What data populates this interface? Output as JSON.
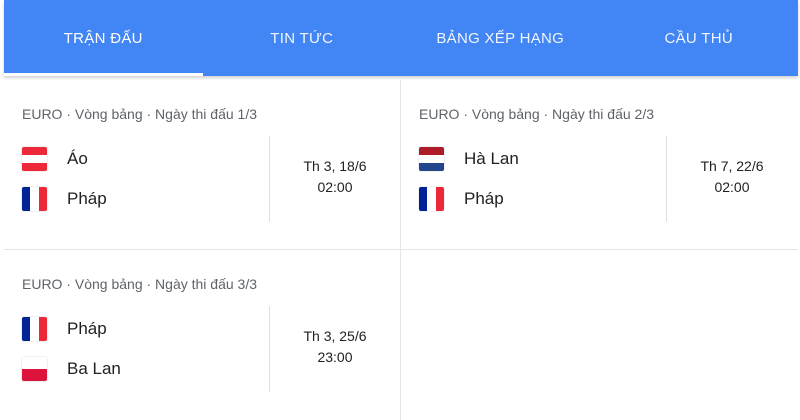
{
  "tabs": [
    {
      "label": "TRẬN ĐẤU",
      "active": true
    },
    {
      "label": "TIN TỨC",
      "active": false
    },
    {
      "label": "BẢNG XẾP HẠNG",
      "active": false
    },
    {
      "label": "CẦU THỦ",
      "active": false
    }
  ],
  "matches": [
    {
      "header": "EURO · Vòng bảng · Ngày thi đấu 1/3",
      "home": {
        "name": "Áo",
        "flag": "austria-flag"
      },
      "away": {
        "name": "Pháp",
        "flag": "france-flag"
      },
      "date": "Th 3, 18/6",
      "time": "02:00"
    },
    {
      "header": "EURO · Vòng bảng · Ngày thi đấu 2/3",
      "home": {
        "name": "Hà Lan",
        "flag": "netherlands-flag"
      },
      "away": {
        "name": "Pháp",
        "flag": "france-flag"
      },
      "date": "Th 7, 22/6",
      "time": "02:00"
    },
    {
      "header": "EURO · Vòng bảng · Ngày thi đấu 3/3",
      "home": {
        "name": "Pháp",
        "flag": "france-flag"
      },
      "away": {
        "name": "Ba Lan",
        "flag": "poland-flag"
      },
      "date": "Th 3, 25/6",
      "time": "23:00"
    }
  ],
  "colors": {
    "tab_bar": "#4285f4",
    "text_primary": "#202124",
    "text_secondary": "#5f6368",
    "austria_red": "#ed2939",
    "france_blue": "#002395",
    "france_red": "#ed2939",
    "netherlands_red": "#ae1c28",
    "netherlands_blue": "#21468b",
    "poland_red": "#dc143c"
  }
}
